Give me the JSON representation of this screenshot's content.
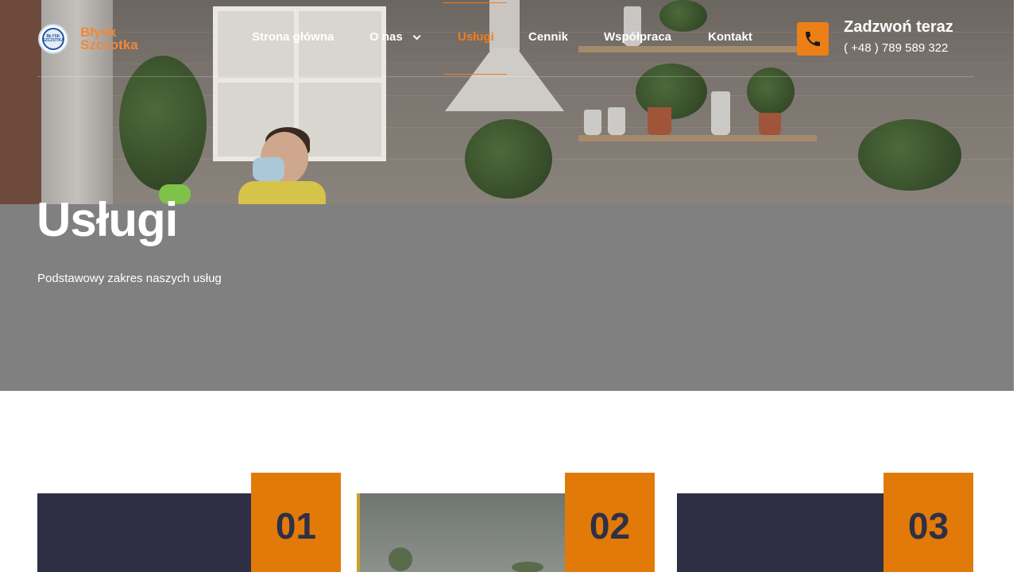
{
  "brand": {
    "name": "Błysk Szczotka",
    "name_line1": "Błysk",
    "name_line2": "Szczotka",
    "badge_text": "BŁYSK SZCZOTKA",
    "accent_color": "#f07e1d"
  },
  "nav": {
    "items": [
      {
        "label": "Strona główna",
        "active": false
      },
      {
        "label": "O nas",
        "active": false,
        "has_dropdown": true
      },
      {
        "label": "Usługi",
        "active": true
      },
      {
        "label": "Cennik",
        "active": false
      },
      {
        "label": "Współpraca",
        "active": false
      },
      {
        "label": "Kontakt",
        "active": false
      }
    ]
  },
  "call": {
    "icon": "phone-icon",
    "title": "Zadzwoń teraz",
    "number": "( +48 ) 789 589 322"
  },
  "hero": {
    "title": "Usługi",
    "subtitle": "Podstawowy zakres naszych usług"
  },
  "cards": [
    {
      "number": "01",
      "image_color": "#2e2f45"
    },
    {
      "number": "02",
      "image_color": "#6f7570"
    },
    {
      "number": "03",
      "image_color": "#2e2f45"
    }
  ],
  "colors": {
    "orange": "#e17a09",
    "navy": "#2e2f45",
    "hero_overlay": "#808080"
  }
}
